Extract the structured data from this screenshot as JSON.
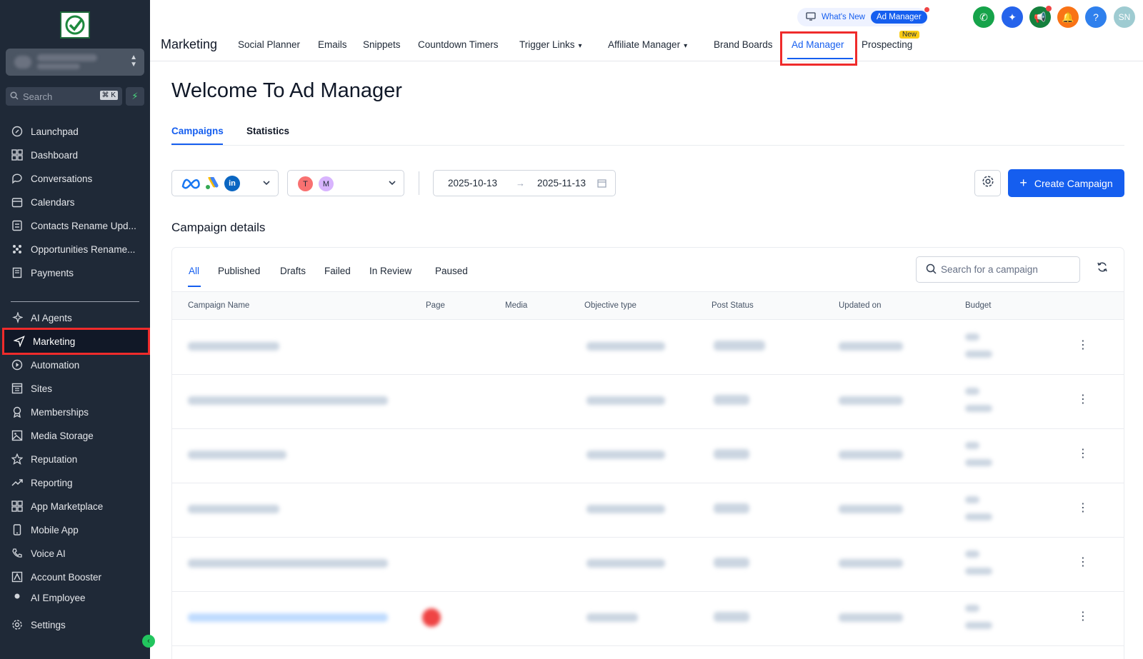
{
  "sidebar": {
    "search_placeholder": "Search",
    "search_shortcut": "⌘ K",
    "items": [
      {
        "label": "Launchpad",
        "icon": "rocket-icon"
      },
      {
        "label": "Dashboard",
        "icon": "grid-icon"
      },
      {
        "label": "Conversations",
        "icon": "chat-icon"
      },
      {
        "label": "Calendars",
        "icon": "calendar-icon"
      },
      {
        "label": "Contacts Rename Upd...",
        "icon": "contacts-icon"
      },
      {
        "label": "Opportunities Rename...",
        "icon": "opportunities-icon"
      },
      {
        "label": "Payments",
        "icon": "payments-icon"
      },
      {
        "label": "AI Agents",
        "icon": "sparkle-icon"
      },
      {
        "label": "Marketing",
        "icon": "send-icon"
      },
      {
        "label": "Automation",
        "icon": "automation-icon"
      },
      {
        "label": "Sites",
        "icon": "sites-icon"
      },
      {
        "label": "Memberships",
        "icon": "membership-icon"
      },
      {
        "label": "Media Storage",
        "icon": "image-icon"
      },
      {
        "label": "Reputation",
        "icon": "star-icon"
      },
      {
        "label": "Reporting",
        "icon": "trend-icon"
      },
      {
        "label": "App Marketplace",
        "icon": "grid-icon"
      },
      {
        "label": "Mobile App",
        "icon": "phone-icon"
      },
      {
        "label": "Voice AI",
        "icon": "voice-icon"
      },
      {
        "label": "Account Booster",
        "icon": "booster-icon"
      },
      {
        "label": "AI Employee",
        "icon": "dot-icon"
      },
      {
        "label": "Settings",
        "icon": "gear-icon"
      }
    ]
  },
  "header": {
    "section_title": "Marketing",
    "nav": [
      "Social Planner",
      "Emails",
      "Snippets",
      "Countdown Timers",
      "Trigger Links",
      "Affiliate Manager",
      "Brand Boards",
      "Ad Manager",
      "Prospecting"
    ],
    "new_badge": "New",
    "whats_new": "What's New",
    "whats_new_pill": "Ad Manager",
    "user_initials": "SN",
    "help_label": "?"
  },
  "main": {
    "title": "Welcome To Ad Manager",
    "tabs": [
      "Campaigns",
      "Statistics"
    ],
    "account_avatars": [
      "T",
      "M"
    ],
    "date_from": "2025-10-13",
    "date_to": "2025-11-13",
    "create_label": "Create Campaign",
    "details_title": "Campaign details",
    "status_tabs": [
      "All",
      "Published",
      "Drafts",
      "Failed",
      "In Review",
      "Paused"
    ],
    "search_placeholder": "Search for a campaign",
    "columns": [
      "Campaign Name",
      "Page",
      "Media",
      "Objective type",
      "Post Status",
      "Updated on",
      "Budget"
    ]
  },
  "colors": {
    "sidebar_bg": "#1f2937",
    "accent": "#155eef",
    "highlight": "#ef2b2b"
  }
}
